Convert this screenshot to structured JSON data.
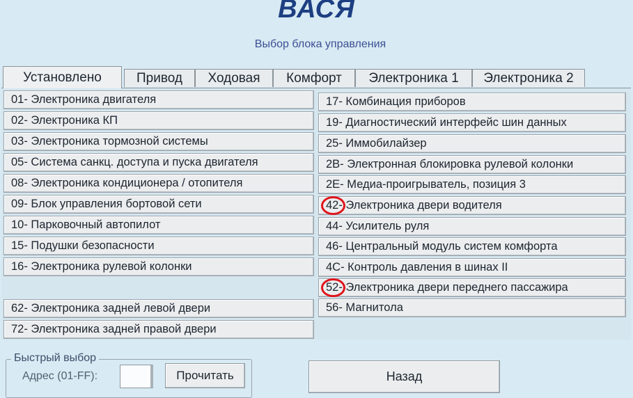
{
  "header": {
    "title": "ВАСЯ",
    "subtitle": "Выбор блока управления"
  },
  "tabs": [
    {
      "label": "Установлено",
      "active": true
    },
    {
      "label": "Привод"
    },
    {
      "label": "Ходовая"
    },
    {
      "label": "Комфорт"
    },
    {
      "label": "Электроника 1"
    },
    {
      "label": "Электроника 2"
    }
  ],
  "modules_left": [
    {
      "label": "01- Электроника двигателя"
    },
    {
      "label": "02- Электроника КП"
    },
    {
      "label": "03- Электроника тормозной системы"
    },
    {
      "label": "05- Система санкц. доступа и пуска двигателя"
    },
    {
      "label": "08- Электроника кондиционера / отопителя"
    },
    {
      "label": "09- Блок управления бортовой сети"
    },
    {
      "label": "10- Парковочный автопилот"
    },
    {
      "label": "15- Подушки безопасности"
    },
    {
      "label": "16- Электроника рулевой колонки"
    },
    {
      "label": "62- Электроника задней левой двери"
    },
    {
      "label": "72- Электроника задней правой двери"
    }
  ],
  "modules_right": [
    {
      "label": "17- Комбинация приборов"
    },
    {
      "label": "19- Диагностический интерфейс шин данных"
    },
    {
      "label": "25- Иммобилайзер"
    },
    {
      "label": "2B- Электронная блокировка рулевой колонки"
    },
    {
      "label": "2E- Медиа-проигрыватель, позиция 3"
    },
    {
      "label": "42- Электроника двери водителя",
      "highlighted": true
    },
    {
      "label": "44- Усилитель руля"
    },
    {
      "label": "46- Центральный модуль систем комфорта"
    },
    {
      "label": "4C- Контроль давления в шинах II"
    },
    {
      "label": "52- Электроника двери переднего пассажира",
      "highlighted": true
    },
    {
      "label": "56- Магнитола"
    }
  ],
  "quick_select": {
    "legend": "Быстрый выбор",
    "address_label": "Адрес (01-FF):",
    "address_value": "",
    "read_button": "Прочитать"
  },
  "back_button": "Назад",
  "colors": {
    "background": "#d8eaf3",
    "title": "#1d3f82",
    "highlight_circle": "#e0141b"
  }
}
